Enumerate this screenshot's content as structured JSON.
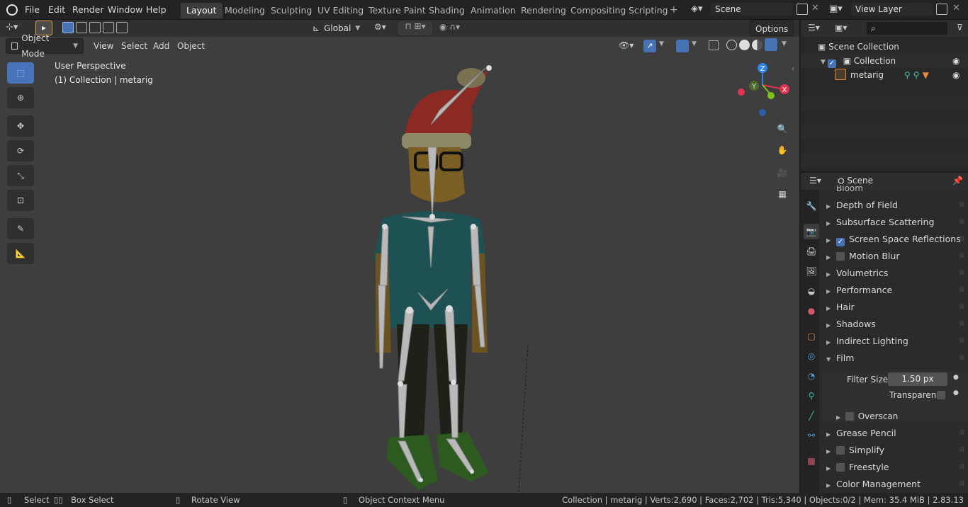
{
  "menus": [
    "File",
    "Edit",
    "Render",
    "Window",
    "Help"
  ],
  "workspaces": [
    "Layout",
    "Modeling",
    "Sculpting",
    "UV Editing",
    "Texture Paint",
    "Shading",
    "Animation",
    "Rendering",
    "Compositing",
    "Scripting"
  ],
  "scene_name": "Scene",
  "view_layer": "View Layer",
  "header": {
    "orientation": "Global",
    "options": "Options",
    "mode": "Object Mode",
    "view": "View",
    "select": "Select",
    "add": "Add",
    "object": "Object"
  },
  "viewport": {
    "perspective": "User Perspective",
    "collection_info": "(1) Collection | metarig",
    "gizmo": {
      "x": "X",
      "y": "Y",
      "z": "Z"
    }
  },
  "outliner": {
    "root": "Scene Collection",
    "collection": "Collection",
    "object": "metarig"
  },
  "properties": {
    "header": "Scene",
    "partial": "Bloom",
    "sections": [
      {
        "label": "Depth of Field",
        "checkbox": null
      },
      {
        "label": "Subsurface Scattering",
        "checkbox": null
      },
      {
        "label": "Screen Space Reflections",
        "checkbox": true
      },
      {
        "label": "Motion Blur",
        "checkbox": false
      },
      {
        "label": "Volumetrics",
        "checkbox": null
      },
      {
        "label": "Performance",
        "checkbox": null
      },
      {
        "label": "Hair",
        "checkbox": null
      },
      {
        "label": "Shadows",
        "checkbox": null
      },
      {
        "label": "Indirect Lighting",
        "checkbox": null
      },
      {
        "label": "Film",
        "checkbox": null
      }
    ],
    "film": {
      "filter_size_label": "Filter Size",
      "filter_size_value": "1.50 px",
      "transparent_label": "Transparent",
      "overscan_label": "Overscan"
    },
    "sections_after": [
      {
        "label": "Grease Pencil",
        "checkbox": null
      },
      {
        "label": "Simplify",
        "checkbox": false
      },
      {
        "label": "Freestyle",
        "checkbox": false
      },
      {
        "label": "Color Management",
        "checkbox": null
      }
    ]
  },
  "statusbar": {
    "select": "Select",
    "box_select": "Box Select",
    "rotate_view": "Rotate View",
    "context_menu": "Object Context Menu",
    "stats": "Collection | metarig | Verts:2,690 | Faces:2,702 | Tris:5,340 | Objects:0/2 | Mem: 35.4 MiB | 2.83.13"
  },
  "colors": {
    "accent": "#4772b3",
    "x_axis": "#e0334f",
    "y_axis": "#7ec31b",
    "z_axis": "#2f83e6"
  }
}
